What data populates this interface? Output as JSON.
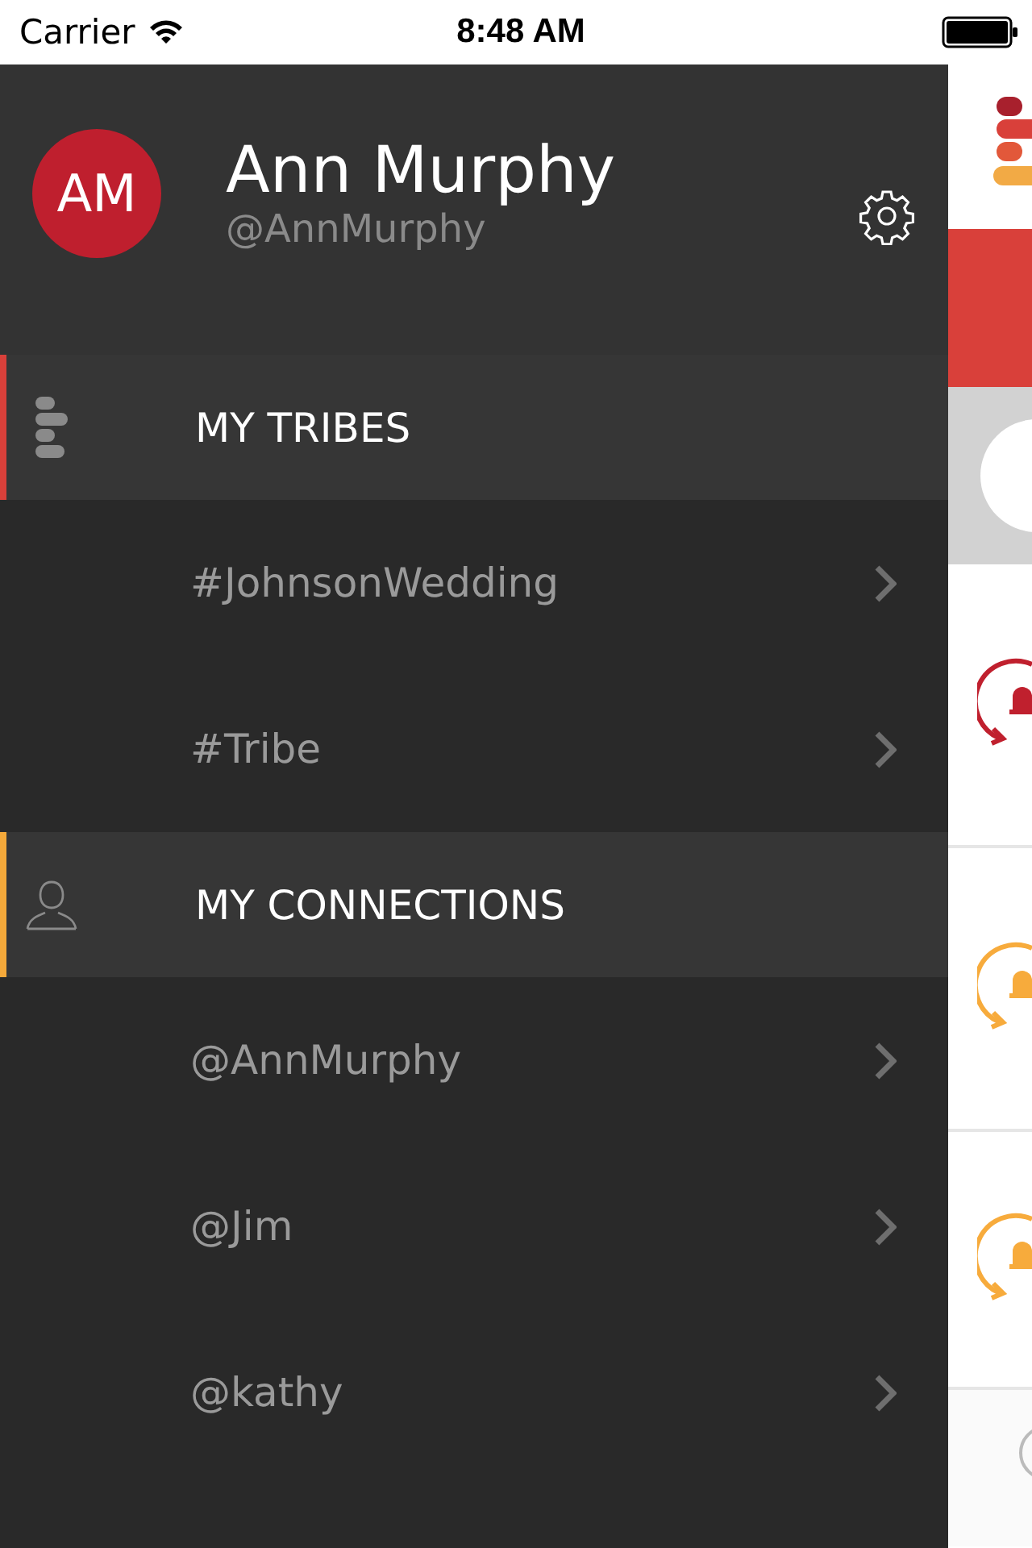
{
  "status_bar": {
    "carrier": "Carrier",
    "time": "8:48 AM"
  },
  "profile": {
    "initials": "AM",
    "name": "Ann Murphy",
    "handle": "@AnnMurphy"
  },
  "sections": [
    {
      "kind": "tribes",
      "title": "MY TRIBES",
      "color": "#d9403a",
      "items": [
        "#JohnsonWedding",
        "#Tribe"
      ]
    },
    {
      "kind": "connections",
      "title": "MY CONNECTIONS",
      "color": "#f5a93a",
      "items": [
        "@AnnMurphy",
        "@Jim",
        "@kathy"
      ]
    }
  ],
  "behind": {
    "alerts": [
      {
        "color": "#c0202e"
      },
      {
        "color": "#f7ab3c"
      },
      {
        "color": "#f7ab3c"
      }
    ]
  }
}
